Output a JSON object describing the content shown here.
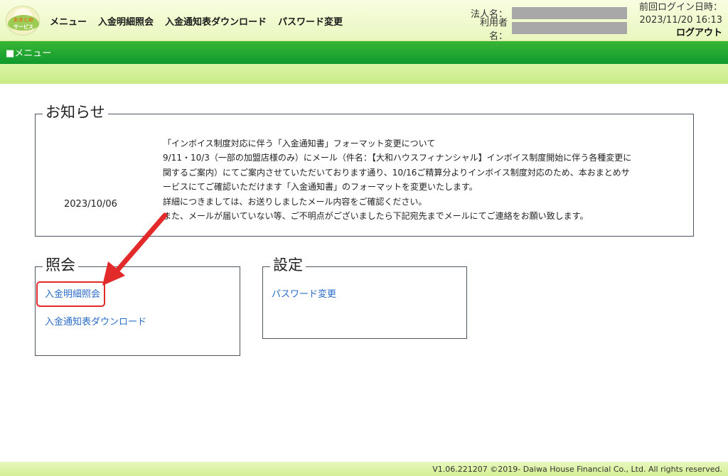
{
  "logo": {
    "line1": "おまとめ",
    "line2": "サービス"
  },
  "topnav": {
    "menu": "メニュー",
    "deposit_inquiry": "入金明細照会",
    "download": "入金通知表ダウンロード",
    "password": "パスワード変更"
  },
  "user": {
    "corp_label": "法人名：",
    "user_label": "利用者名："
  },
  "last_login": {
    "label": "前回ログイン日時：",
    "value": "2023/11/20 16:13",
    "logout": "ログアウト"
  },
  "menubar": {
    "title": "■メニュー"
  },
  "notice": {
    "legend": "お知らせ",
    "date": "2023/10/06",
    "lines": [
      "「インボイス制度対応に伴う「入金通知書」フォーマット変更について",
      "9/11・10/3（一部の加盟店様のみ）にメール（件名：【大和ハウスフィナンシャル】インボイス制度開始に伴う各種変更に",
      "関するご案内）にてご案内させていただいております通り、10/16ご精算分よりインボイス制度対応のため、本おまとめサ",
      "ービスにてご確認いただけます「入金通知書」のフォーマットを変更いたします。",
      "詳細につきましては、お送りしましたメール内容をご確認ください。",
      "また、メールが届いていない等、ご不明点がございましたら下記宛先までメールにてご連絡をお願い致します。"
    ]
  },
  "inquiry": {
    "legend": "照会",
    "link1": "入金明細照会",
    "link2": "入金通知表ダウンロード"
  },
  "settings": {
    "legend": "設定",
    "link1": "パスワード変更"
  },
  "footer": {
    "text": "V1.06.221207  ©2019- Daiwa House Financial Co., Ltd. All rights reserved."
  },
  "colors": {
    "menubar": "#1aa336",
    "link": "#2a6cc8",
    "highlight": "#e32a2a"
  }
}
